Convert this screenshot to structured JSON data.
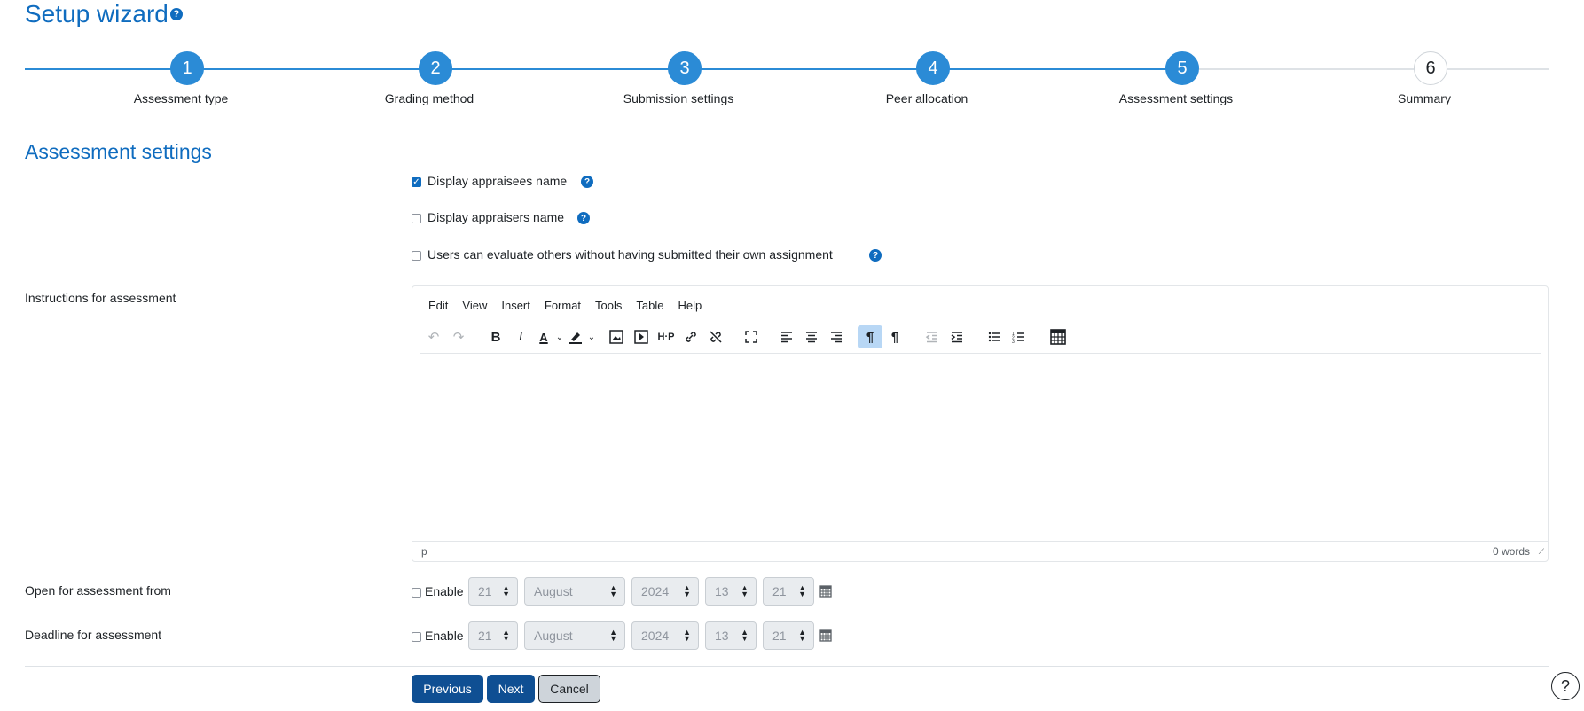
{
  "header": {
    "title": "Setup wizard",
    "help_glyph": "?"
  },
  "steps": [
    {
      "number": "1",
      "label": "Assessment type",
      "state": "complete"
    },
    {
      "number": "2",
      "label": "Grading method",
      "state": "complete"
    },
    {
      "number": "3",
      "label": "Submission settings",
      "state": "complete"
    },
    {
      "number": "4",
      "label": "Peer allocation",
      "state": "complete"
    },
    {
      "number": "5",
      "label": "Assessment settings",
      "state": "current"
    },
    {
      "number": "6",
      "label": "Summary",
      "state": "upcoming"
    }
  ],
  "section": {
    "title": "Assessment settings"
  },
  "options": [
    {
      "label": "Display appraisees name",
      "checked": true
    },
    {
      "label": "Display appraisers name",
      "checked": false
    },
    {
      "label": "Users can evaluate others without having submitted their own assignment",
      "checked": false
    }
  ],
  "instructions": {
    "label": "Instructions for assessment",
    "menu": [
      "Edit",
      "View",
      "Insert",
      "Format",
      "Tools",
      "Table",
      "Help"
    ],
    "status_path": "p",
    "word_count": "0 words"
  },
  "open_from": {
    "label": "Open for assessment from",
    "enable_label": "Enable",
    "enabled": false,
    "day": "21",
    "month": "August",
    "year": "2024",
    "hour": "13",
    "minute": "21"
  },
  "deadline": {
    "label": "Deadline for assessment",
    "enable_label": "Enable",
    "enabled": false,
    "day": "21",
    "month": "August",
    "year": "2024",
    "hour": "13",
    "minute": "21"
  },
  "buttons": {
    "previous": "Previous",
    "next": "Next",
    "cancel": "Cancel"
  },
  "colors": {
    "accent": "#0f6cbf",
    "step": "#2b8bd6",
    "primary_button": "#0f4f93"
  }
}
